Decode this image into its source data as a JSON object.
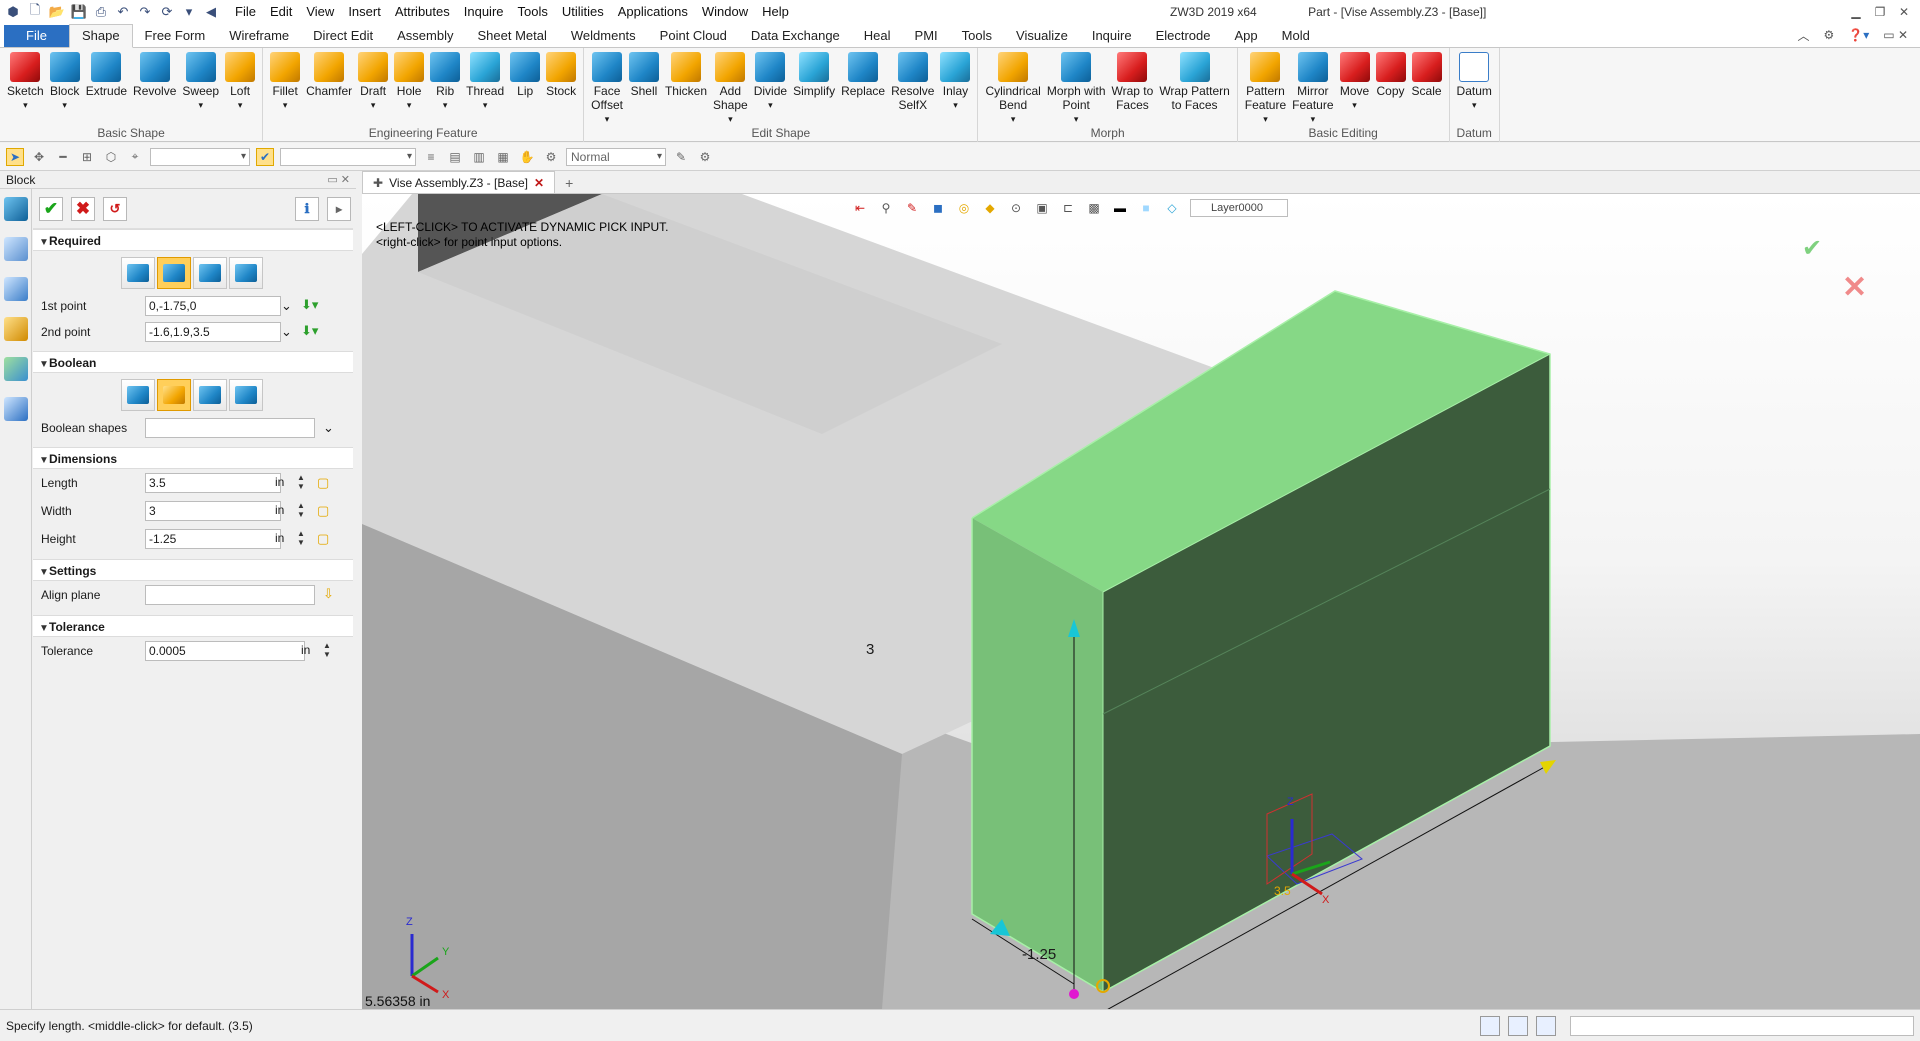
{
  "titlebar": {
    "menu": [
      "File",
      "Edit",
      "View",
      "Insert",
      "Attributes",
      "Inquire",
      "Tools",
      "Utilities",
      "Applications",
      "Window",
      "Help"
    ],
    "app_name": "ZW3D 2019  x64",
    "doc_title": "Part - [Vise Assembly.Z3 - [Base]]"
  },
  "tabs": [
    "Shape",
    "Free Form",
    "Wireframe",
    "Direct Edit",
    "Assembly",
    "Sheet Metal",
    "Weldments",
    "Point Cloud",
    "Data Exchange",
    "Heal",
    "PMI",
    "Tools",
    "Visualize",
    "Inquire",
    "Electrode",
    "App",
    "Mold"
  ],
  "file_tab": "File",
  "ribbon": {
    "groups": [
      {
        "label": "Basic Shape",
        "buttons": [
          {
            "name": "sketch",
            "label": "Sketch",
            "icon": "red",
            "drop": true
          },
          {
            "name": "block",
            "label": "Block",
            "icon": "blue",
            "drop": true
          },
          {
            "name": "extrude",
            "label": "Extrude",
            "icon": "blue",
            "drop": false
          },
          {
            "name": "revolve",
            "label": "Revolve",
            "icon": "blue",
            "drop": false
          },
          {
            "name": "sweep",
            "label": "Sweep",
            "icon": "blue",
            "drop": true
          },
          {
            "name": "loft",
            "label": "Loft",
            "icon": "orange",
            "drop": true
          }
        ]
      },
      {
        "label": "Engineering Feature",
        "buttons": [
          {
            "name": "fillet",
            "label": "Fillet",
            "icon": "orange",
            "drop": true
          },
          {
            "name": "chamfer",
            "label": "Chamfer",
            "icon": "orange",
            "drop": false
          },
          {
            "name": "draft",
            "label": "Draft",
            "icon": "orange",
            "drop": true
          },
          {
            "name": "hole",
            "label": "Hole",
            "icon": "orange",
            "drop": true
          },
          {
            "name": "rib",
            "label": "Rib",
            "icon": "blue",
            "drop": true
          },
          {
            "name": "thread",
            "label": "Thread",
            "icon": "teal",
            "drop": true
          },
          {
            "name": "lip",
            "label": "Lip",
            "icon": "blue",
            "drop": false
          },
          {
            "name": "stock",
            "label": "Stock",
            "icon": "orange",
            "drop": false
          }
        ]
      },
      {
        "label": "Edit Shape",
        "buttons": [
          {
            "name": "face-offset",
            "label": "Face\nOffset",
            "icon": "blue",
            "drop": true
          },
          {
            "name": "shell",
            "label": "Shell",
            "icon": "blue",
            "drop": false
          },
          {
            "name": "thicken",
            "label": "Thicken",
            "icon": "orange",
            "drop": false
          },
          {
            "name": "add-shape",
            "label": "Add\nShape",
            "icon": "orange",
            "drop": true
          },
          {
            "name": "divide",
            "label": "Divide",
            "icon": "blue",
            "drop": true
          },
          {
            "name": "simplify",
            "label": "Simplify",
            "icon": "teal",
            "drop": false
          },
          {
            "name": "replace",
            "label": "Replace",
            "icon": "blue",
            "drop": false
          },
          {
            "name": "resolve-selfx",
            "label": "Resolve\nSelfX",
            "icon": "blue",
            "drop": false
          },
          {
            "name": "inlay",
            "label": "Inlay",
            "icon": "teal",
            "drop": true
          }
        ]
      },
      {
        "label": "Morph",
        "buttons": [
          {
            "name": "cylindrical-bend",
            "label": "Cylindrical\nBend",
            "icon": "orange",
            "drop": true
          },
          {
            "name": "morph-with-point",
            "label": "Morph with\nPoint",
            "icon": "blue",
            "drop": true
          },
          {
            "name": "wrap-to-faces",
            "label": "Wrap to\nFaces",
            "icon": "red",
            "drop": false
          },
          {
            "name": "wrap-pattern",
            "label": "Wrap Pattern\nto Faces",
            "icon": "teal",
            "drop": false
          }
        ]
      },
      {
        "label": "Basic Editing",
        "buttons": [
          {
            "name": "pattern-feature",
            "label": "Pattern\nFeature",
            "icon": "orange",
            "drop": true
          },
          {
            "name": "mirror-feature",
            "label": "Mirror\nFeature",
            "icon": "blue",
            "drop": true
          },
          {
            "name": "move",
            "label": "Move",
            "icon": "red",
            "drop": true
          },
          {
            "name": "copy",
            "label": "Copy",
            "icon": "red",
            "drop": false
          },
          {
            "name": "scale",
            "label": "Scale",
            "icon": "red",
            "drop": false
          }
        ]
      },
      {
        "label": "Datum",
        "buttons": [
          {
            "name": "datum",
            "label": "Datum",
            "icon": "datum",
            "drop": true
          }
        ]
      }
    ]
  },
  "toolrow": {
    "mode": "Normal"
  },
  "panel": {
    "title": "Block",
    "required": {
      "header": "Required",
      "first_point_label": "1st point",
      "first_point_value": "0,-1.75,0",
      "second_point_label": "2nd point",
      "second_point_value": "-1.6,1.9,3.5"
    },
    "boolean": {
      "header": "Boolean",
      "shapes_label": "Boolean shapes",
      "shapes_value": ""
    },
    "dimensions": {
      "header": "Dimensions",
      "length_label": "Length",
      "length_value": "3.5",
      "length_unit": "in",
      "width_label": "Width",
      "width_value": "3",
      "width_unit": "in",
      "height_label": "Height",
      "height_value": "-1.25",
      "height_unit": "in"
    },
    "settings": {
      "header": "Settings",
      "align_label": "Align plane",
      "align_value": ""
    },
    "tolerance": {
      "header": "Tolerance",
      "label": "Tolerance",
      "value": "0.0005",
      "unit": "in"
    }
  },
  "document": {
    "tab_label": "Vise Assembly.Z3 - [Base]"
  },
  "viewport": {
    "hint_line1": "<LEFT-CLICK> TO ACTIVATE DYNAMIC PICK INPUT.",
    "hint_line2": "<right-click> for point input options.",
    "layer": "Layer0000",
    "dim_height": "3",
    "dim_depth": "-1.25",
    "dim_length": "3.5",
    "coordinate_readout": "5.56358 in",
    "axis_x": "X",
    "axis_y": "Y",
    "axis_z": "Z"
  },
  "status": {
    "text": "Specify length.  <middle-click> for default. (3.5)"
  },
  "colors": {
    "block_top": "#86d886",
    "block_front": "#78c078",
    "block_side": "#3c5c3c",
    "accent": "#2b6fc2"
  }
}
